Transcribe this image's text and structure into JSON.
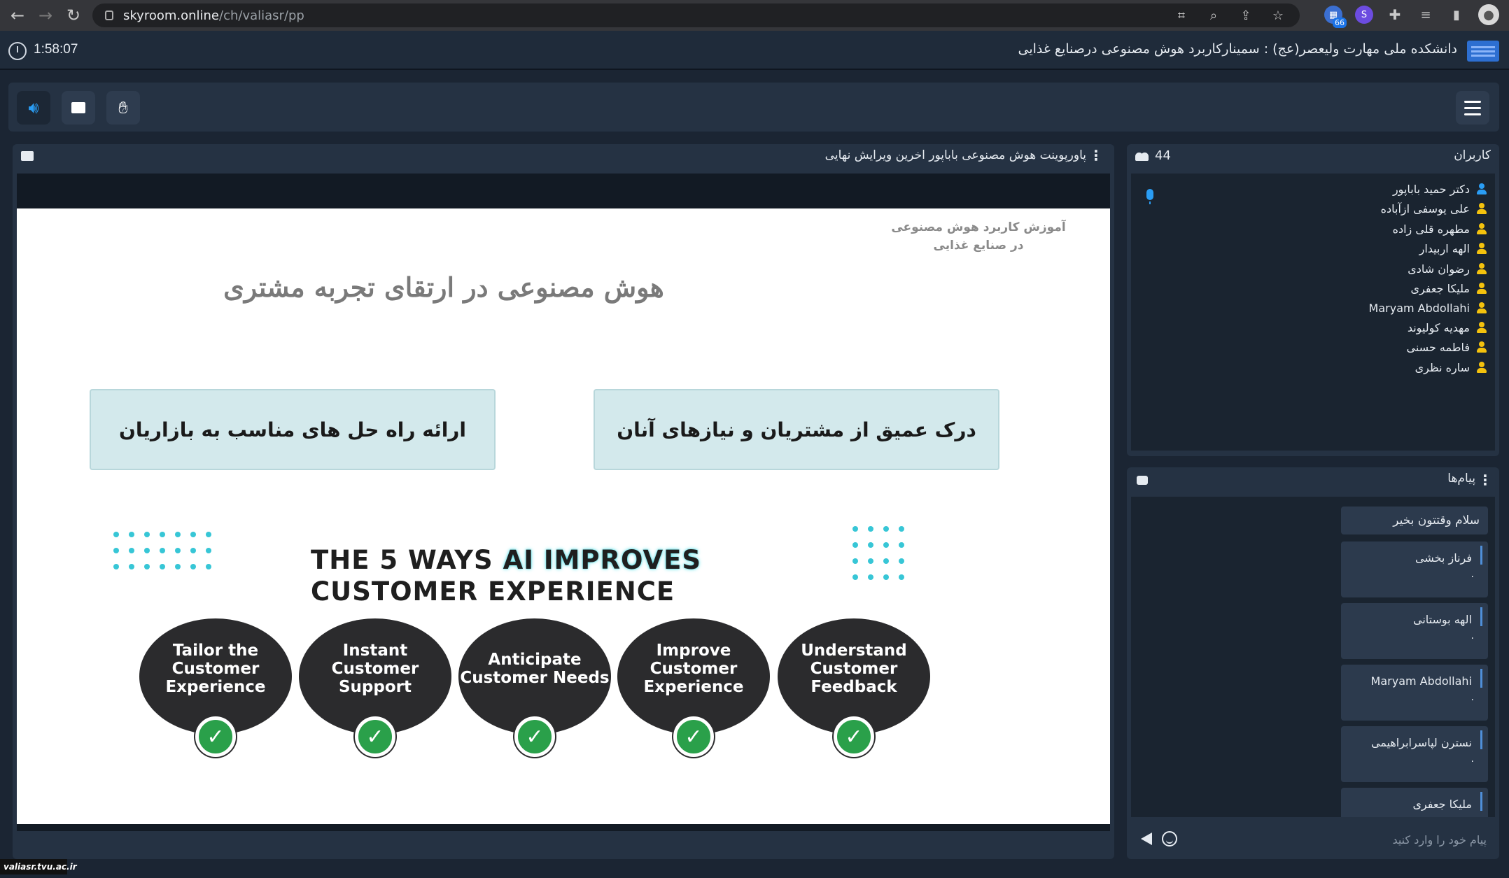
{
  "browser": {
    "url_host": "skyroom.online",
    "url_path": "/ch/valiasr/pp",
    "extension_badge": "66"
  },
  "header": {
    "timer": "1:58:07",
    "room_title": "دانشکده ملی مهارت ولیعصر(عج) : سمینارکاربرد هوش مصنوعی درصنایع غذایی"
  },
  "presentation": {
    "file_title": "پاورپوینت هوش مصنوعی باباپور اخرین ویرایش نهایی",
    "slide": {
      "subtitle": "آموزش کاربرد هوش مصنوعی در صنایع غذایی",
      "heading": "هوش مصنوعی در ارتقای تجربه مشتری",
      "box_left": "ارائه راه حل های مناسب به بازاریان",
      "box_right": "درک عمیق از مشتریان و نیازهای آنان",
      "ways_line1_a": "THE 5 WAYS ",
      "ways_line1_b": "AI IMPROVES",
      "ways_line2": "CUSTOMER EXPERIENCE",
      "ways": [
        {
          "label": "Tailor the Customer Experience"
        },
        {
          "label": "Instant Customer Support"
        },
        {
          "label": "Anticipate Customer Needs"
        },
        {
          "label": "Improve Customer Experience"
        },
        {
          "label": "Understand Customer Feedback"
        }
      ]
    }
  },
  "users": {
    "title": "کاربران",
    "count": "44",
    "list": [
      {
        "name": "دکتر حمید باباپور",
        "color": "#2a9df4"
      },
      {
        "name": "علی یوسفی ازآباده",
        "color": "#f4c20d"
      },
      {
        "name": "مطهره قلی زاده",
        "color": "#f4c20d"
      },
      {
        "name": "الهه اربیدار",
        "color": "#f4c20d"
      },
      {
        "name": "رضوان شادی",
        "color": "#f4c20d"
      },
      {
        "name": "ملیکا جعفری",
        "color": "#f4c20d"
      },
      {
        "name": "Maryam Abdollahi",
        "color": "#f4c20d"
      },
      {
        "name": "مهدیه کولیوند",
        "color": "#f4c20d"
      },
      {
        "name": "فاطمه حسنی",
        "color": "#f4c20d"
      },
      {
        "name": "ساره نظری",
        "color": "#f4c20d"
      }
    ]
  },
  "messages": {
    "title": "پیام‌ها",
    "first_message": "سلام وقتتون بخیر",
    "list": [
      {
        "author": "فرناز بخشی",
        "body": "."
      },
      {
        "author": "الهه بوستانی",
        "body": "."
      },
      {
        "author": "Maryam Abdollahi",
        "body": "."
      },
      {
        "author": "نسترن لپاسرابراهیمی",
        "body": "."
      },
      {
        "author": "ملیکا جعفری",
        "body": ""
      }
    ],
    "composer_placeholder": "پیام خود را وارد کنید"
  },
  "footer": {
    "watermark": "valiasr.tvu.ac.ir"
  }
}
